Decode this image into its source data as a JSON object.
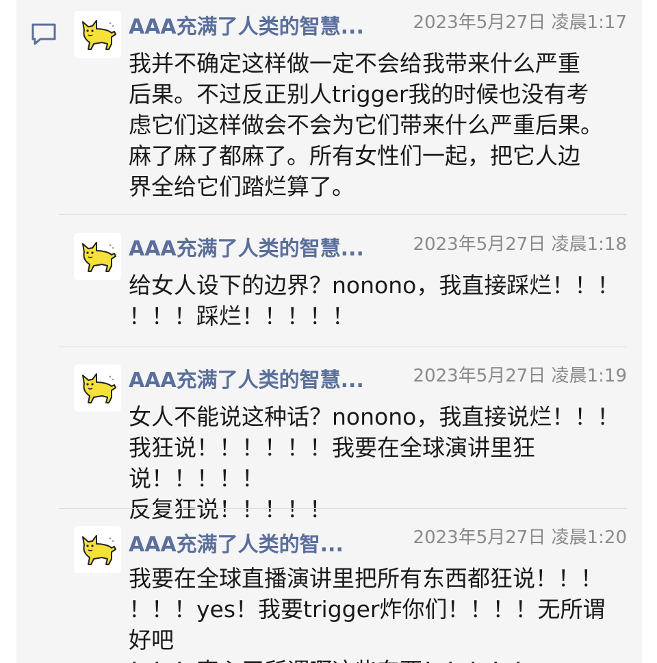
{
  "comments": [
    {
      "author": "AAA充满了人类的智慧...",
      "timestamp": "2023年5月27日 凌晨1:17",
      "text": "我并不确定这样做一定不会给我带来什么严重\n后果。不过反正别人trigger我的时候也没有考\n虑它们这样做会不会为它们带来什么严重后果。\n麻了麻了都麻了。所有女性们一起，把它人边\n界全给它们踏烂算了。",
      "avatar_icon": "yellow-cat-icon"
    },
    {
      "author": "AAA充满了人类的智慧...",
      "timestamp": "2023年5月27日 凌晨1:18",
      "text": "给女人设下的边界？nonono，我直接踩烂！！！\n！！！踩烂！！！！！",
      "avatar_icon": "yellow-cat-icon"
    },
    {
      "author": "AAA充满了人类的智慧...",
      "timestamp": "2023年5月27日 凌晨1:19",
      "text": "女人不能说这种话？nonono，我直接说烂！！！\n我狂说！！！！！！我要在全球演讲里狂说！！！！！\n反复狂说！！！！！",
      "avatar_icon": "yellow-cat-icon"
    },
    {
      "author": "AAA充满了人类的智...",
      "timestamp": "2023年5月27日 凌晨1:20",
      "text": "我要在全球直播演讲里把所有东西都狂说！！！\n！！！yes！我要trigger炸你们！！！！无所谓好吧\n！！！真心无所谓啊这些东西！！！！！",
      "avatar_icon": "yellow-cat-icon"
    }
  ],
  "colors": {
    "author": "#5a6f9c",
    "timestamp": "#8a8a8a",
    "text": "#1a1a1a",
    "panel": "#f5f5f5",
    "cat": "#f5e13a",
    "comment_icon": "#5a6f9c"
  },
  "icons": {
    "comment": "speech-bubble-icon"
  }
}
